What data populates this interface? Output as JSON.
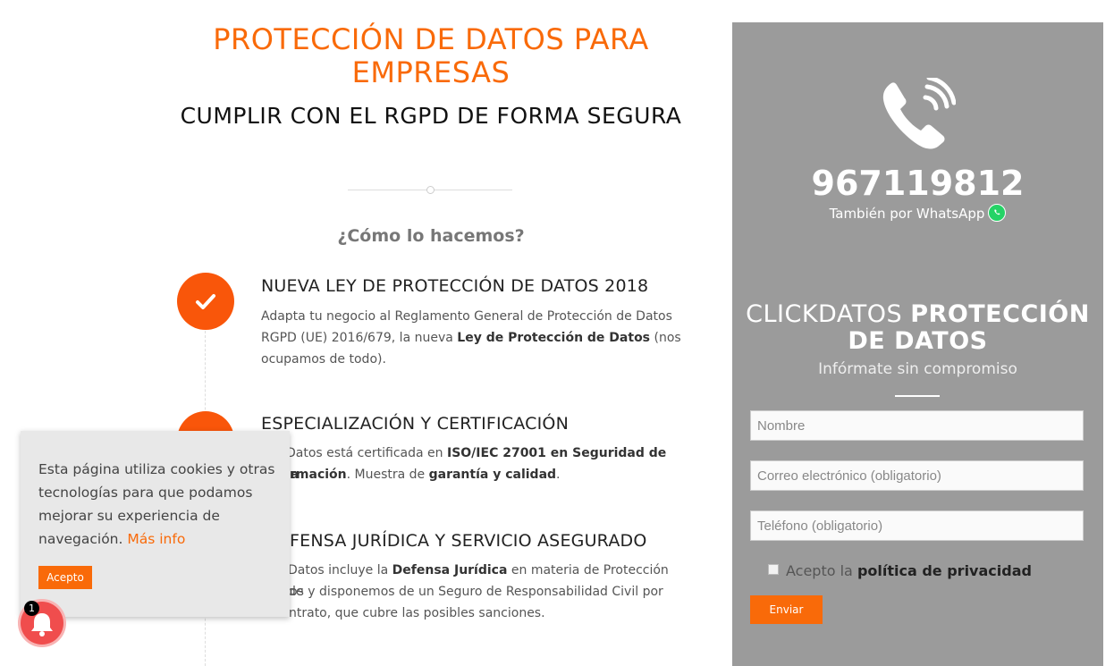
{
  "hero": {
    "title": "PROTECCIÓN DE DATOS PARA EMPRESAS",
    "subtitle": "CUMPLIR CON EL RGPD DE FORMA SEGURA",
    "question": "¿Cómo lo hacemos?"
  },
  "features": [
    {
      "title": "NUEVA LEY DE PROTECCIÓN DE DATOS 2018",
      "text_a": "Adapta tu negocio al Reglamento General de Protección de Datos RGPD (UE) 2016/679, la nueva ",
      "text_b": "Ley de Protección de Datos",
      "text_c": " (nos ocupamos de todo)."
    },
    {
      "title": "ESPECIALIZACIÓN Y CERTIFICACIÓN",
      "text_a": "Datos está certificada en ",
      "text_b": "ISO/IEC 27001 en Seguridad de la",
      "text_c": "rmación",
      "text_d": ". Muestra de ",
      "text_e": "garantía y calidad",
      "text_f": "."
    },
    {
      "title": "FENSA JURÍDICA Y SERVICIO ASEGURADO",
      "text_a": "Datos incluye la ",
      "text_b": "Defensa Jurídica",
      "text_c": " en materia de Protección de",
      "text_d": "os y disponemos de un Seguro de Responsabilidad Civil por",
      "text_e": "ntrato, que cubre las posibles sanciones."
    }
  ],
  "sidebar": {
    "phone": "967119812",
    "whatsapp_label": "También por WhatsApp",
    "brand_light": "CLICKDATOS",
    "brand_bold": "PROTECCIÓN DE DATOS",
    "tagline": "Infórmate sin compromiso",
    "fields": {
      "name_placeholder": "Nombre",
      "email_placeholder": "Correo electrónico (obligatorio)",
      "phone_placeholder": "Teléfono (obligatorio)"
    },
    "privacy_prefix": "Acepto la",
    "privacy_link": "política de privacidad",
    "send_label": "Enviar"
  },
  "cookie": {
    "text": "Esta página utiliza cookies y otras tecnologías para que podamos mejorar su experiencia de navegación.",
    "more_link": "Más info",
    "accept_label": "Acepto"
  },
  "notification": {
    "count": "1"
  },
  "colors": {
    "accent": "#f96a09",
    "sidebar_bg": "#9b9b9b",
    "whatsapp": "#25d366"
  }
}
